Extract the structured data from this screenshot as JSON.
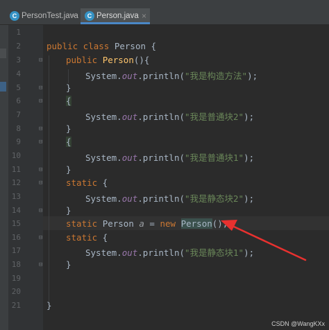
{
  "tabs": [
    {
      "label": "PersonTest.java",
      "icon": "java-class-icon"
    },
    {
      "label": "Person.java",
      "icon": "java-class-icon"
    }
  ],
  "line_numbers": [
    "1",
    "2",
    "3",
    "4",
    "5",
    "6",
    "7",
    "8",
    "9",
    "10",
    "11",
    "12",
    "13",
    "14",
    "15",
    "16",
    "17",
    "18",
    "19",
    "20",
    "21"
  ],
  "code": {
    "l2_kw": "public class ",
    "l2_name": "Person {",
    "l3_kw": "public ",
    "l3_fn": "Person",
    "l3_rest": "(){",
    "l4_a": "System.",
    "l4_out": "out",
    "l4_b": ".println(",
    "l4_str": "\"我是构造方法\"",
    "l4_c": ");",
    "l5": "}",
    "l6": "{",
    "l7_a": "System.",
    "l7_out": "out",
    "l7_b": ".println(",
    "l7_str": "\"我是普通块2\"",
    "l7_c": ");",
    "l8": "}",
    "l9": "{",
    "l10_a": "System.",
    "l10_out": "out",
    "l10_b": ".println(",
    "l10_str": "\"我是普通块1\"",
    "l10_c": ");",
    "l11": "}",
    "l12_kw": "static",
    "l12_rest": " {",
    "l13_a": "System.",
    "l13_out": "out",
    "l13_b": ".println(",
    "l13_str": "\"我是静态块2\"",
    "l13_c": ");",
    "l14": "}",
    "l15_kw": "static ",
    "l15_type": "Person ",
    "l15_var": "a",
    "l15_eq": " = ",
    "l15_new": "new ",
    "l15_ctor": "Person",
    "l15_rest": "();",
    "l16_kw": "static",
    "l16_rest": " {",
    "l17_a": "System.",
    "l17_out": "out",
    "l17_b": ".println(",
    "l17_str": "\"我是静态块1\"",
    "l17_c": ");",
    "l18": "}",
    "l21": "}"
  },
  "annotation_arrow_color": "#e8312f",
  "watermark": "CSDN @WangKXx"
}
